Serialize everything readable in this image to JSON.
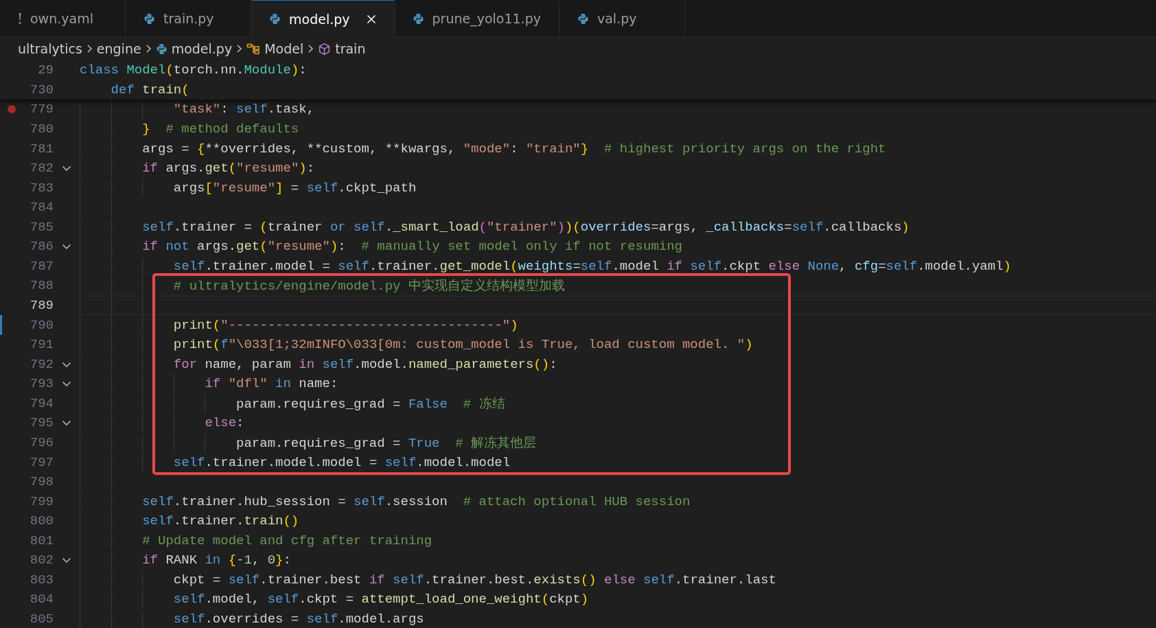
{
  "tabs": [
    {
      "label": "own.yaml",
      "kind": "yaml",
      "selected": false
    },
    {
      "label": "train.py",
      "kind": "python",
      "selected": false
    },
    {
      "label": "model.py",
      "kind": "python",
      "selected": true
    },
    {
      "label": "prune_yolo11.py",
      "kind": "python",
      "selected": false
    },
    {
      "label": "val.py",
      "kind": "python",
      "selected": false
    }
  ],
  "breadcrumb": [
    {
      "label": "ultralytics",
      "kind": "folder"
    },
    {
      "label": "engine",
      "kind": "folder"
    },
    {
      "label": "model.py",
      "kind": "python"
    },
    {
      "label": "Model",
      "kind": "class"
    },
    {
      "label": "train",
      "kind": "method"
    }
  ],
  "sticky_lines": [
    {
      "number": "29",
      "tokens": [
        {
          "kind": "kw",
          "text": "class"
        },
        {
          "kind": "cls",
          "text": " Model"
        },
        {
          "kind": "b1",
          "text": "("
        },
        {
          "kind": "plain",
          "text": "torch.nn."
        },
        {
          "kind": "cls",
          "text": "Module"
        },
        {
          "kind": "b1",
          "text": ")"
        },
        {
          "kind": "plain",
          "text": ":"
        }
      ]
    },
    {
      "number": "730",
      "tokens": [
        {
          "kind": "kw",
          "text": "    def"
        },
        {
          "kind": "fn",
          "text": " train"
        },
        {
          "kind": "b1",
          "text": "("
        }
      ]
    }
  ],
  "lines": [
    {
      "number": "779",
      "breakpoint": true,
      "tokens": [
        {
          "kind": "str",
          "text": "            \"task\""
        },
        {
          "kind": "plain",
          "text": ": "
        },
        {
          "kind": "kw",
          "text": "self"
        },
        {
          "kind": "plain",
          "text": ".task,"
        }
      ]
    },
    {
      "number": "780",
      "tokens": [
        {
          "kind": "b1",
          "text": "        }"
        },
        {
          "kind": "cmt",
          "text": "  # method defaults"
        }
      ]
    },
    {
      "number": "781",
      "tokens": [
        {
          "kind": "plain",
          "text": "        args = "
        },
        {
          "kind": "b1",
          "text": "{"
        },
        {
          "kind": "plain",
          "text": "**overrides, **custom, **kwargs, "
        },
        {
          "kind": "str",
          "text": "\"mode\""
        },
        {
          "kind": "plain",
          "text": ": "
        },
        {
          "kind": "str",
          "text": "\"train\""
        },
        {
          "kind": "b1",
          "text": "}"
        },
        {
          "kind": "cmt",
          "text": "  # highest priority args on the right"
        }
      ]
    },
    {
      "number": "782",
      "expanded": true,
      "tokens": [
        {
          "kind": "ctrl",
          "text": "        if"
        },
        {
          "kind": "plain",
          "text": " args."
        },
        {
          "kind": "fn",
          "text": "get"
        },
        {
          "kind": "b1",
          "text": "("
        },
        {
          "kind": "str",
          "text": "\"resume\""
        },
        {
          "kind": "b1",
          "text": ")"
        },
        {
          "kind": "plain",
          "text": ":"
        }
      ]
    },
    {
      "number": "783",
      "tokens": [
        {
          "kind": "plain",
          "text": "            args"
        },
        {
          "kind": "b1",
          "text": "["
        },
        {
          "kind": "str",
          "text": "\"resume\""
        },
        {
          "kind": "b1",
          "text": "]"
        },
        {
          "kind": "plain",
          "text": " = "
        },
        {
          "kind": "kw",
          "text": "self"
        },
        {
          "kind": "plain",
          "text": ".ckpt_path"
        }
      ]
    },
    {
      "number": "784"
    },
    {
      "number": "785",
      "tokens": [
        {
          "kind": "kw",
          "text": "        self"
        },
        {
          "kind": "plain",
          "text": ".trainer = "
        },
        {
          "kind": "b1",
          "text": "("
        },
        {
          "kind": "plain",
          "text": "trainer "
        },
        {
          "kind": "kw",
          "text": "or"
        },
        {
          "kind": "kw",
          "text": " self"
        },
        {
          "kind": "plain",
          "text": "."
        },
        {
          "kind": "fn",
          "text": "_smart_load"
        },
        {
          "kind": "b2",
          "text": "("
        },
        {
          "kind": "str",
          "text": "\"trainer\""
        },
        {
          "kind": "b2",
          "text": ")"
        },
        {
          "kind": "b1",
          "text": ")("
        },
        {
          "kind": "param",
          "text": "overrides"
        },
        {
          "kind": "plain",
          "text": "=args, "
        },
        {
          "kind": "param",
          "text": "_callbacks"
        },
        {
          "kind": "plain",
          "text": "="
        },
        {
          "kind": "kw",
          "text": "self"
        },
        {
          "kind": "plain",
          "text": ".callbacks"
        },
        {
          "kind": "b1",
          "text": ")"
        }
      ]
    },
    {
      "number": "786",
      "expanded": true,
      "tokens": [
        {
          "kind": "ctrl",
          "text": "        if"
        },
        {
          "kind": "kw",
          "text": " not"
        },
        {
          "kind": "plain",
          "text": " args."
        },
        {
          "kind": "fn",
          "text": "get"
        },
        {
          "kind": "b1",
          "text": "("
        },
        {
          "kind": "str",
          "text": "\"resume\""
        },
        {
          "kind": "b1",
          "text": ")"
        },
        {
          "kind": "plain",
          "text": ":"
        },
        {
          "kind": "cmt",
          "text": "  # manually set model only if not resuming"
        }
      ]
    },
    {
      "number": "787",
      "tokens": [
        {
          "kind": "kw",
          "text": "            self"
        },
        {
          "kind": "plain",
          "text": ".trainer.model = "
        },
        {
          "kind": "kw",
          "text": "self"
        },
        {
          "kind": "plain",
          "text": ".trainer."
        },
        {
          "kind": "fn",
          "text": "get_model"
        },
        {
          "kind": "b1",
          "text": "("
        },
        {
          "kind": "param",
          "text": "weights"
        },
        {
          "kind": "plain",
          "text": "="
        },
        {
          "kind": "kw",
          "text": "self"
        },
        {
          "kind": "plain",
          "text": ".model "
        },
        {
          "kind": "ctrl",
          "text": "if"
        },
        {
          "kind": "kw",
          "text": " self"
        },
        {
          "kind": "plain",
          "text": ".ckpt "
        },
        {
          "kind": "ctrl",
          "text": "else"
        },
        {
          "kind": "kw",
          "text": " None"
        },
        {
          "kind": "plain",
          "text": ", "
        },
        {
          "kind": "param",
          "text": "cfg"
        },
        {
          "kind": "plain",
          "text": "="
        },
        {
          "kind": "kw",
          "text": "self"
        },
        {
          "kind": "plain",
          "text": ".model.yaml"
        },
        {
          "kind": "b1",
          "text": ")"
        }
      ]
    },
    {
      "number": "788",
      "annotated": true,
      "tokens": [
        {
          "kind": "cmt",
          "text": "            # ultralytics/engine/model.py 中实现自定义结构模型加载"
        }
      ]
    },
    {
      "number": "789",
      "annotated": true,
      "current": true
    },
    {
      "number": "790",
      "annotated": true,
      "modified": true,
      "tokens": [
        {
          "kind": "fn",
          "text": "            print"
        },
        {
          "kind": "b1",
          "text": "("
        },
        {
          "kind": "str",
          "text": "\"-----------------------------------\""
        },
        {
          "kind": "b1",
          "text": ")"
        }
      ]
    },
    {
      "number": "791",
      "annotated": true,
      "tokens": [
        {
          "kind": "fn",
          "text": "            print"
        },
        {
          "kind": "b1",
          "text": "("
        },
        {
          "kind": "kw",
          "text": "f"
        },
        {
          "kind": "str",
          "text": "\"\\033[1;32mINFO\\033[0m: custom_model is True, load custom model. \""
        },
        {
          "kind": "b1",
          "text": ")"
        }
      ]
    },
    {
      "number": "792",
      "annotated": true,
      "expanded": true,
      "tokens": [
        {
          "kind": "ctrl",
          "text": "            for"
        },
        {
          "kind": "plain",
          "text": " name, param "
        },
        {
          "kind": "ctrl",
          "text": "in"
        },
        {
          "kind": "kw",
          "text": " self"
        },
        {
          "kind": "plain",
          "text": ".model."
        },
        {
          "kind": "fn",
          "text": "named_parameters"
        },
        {
          "kind": "b1",
          "text": "()"
        },
        {
          "kind": "plain",
          "text": ":"
        }
      ]
    },
    {
      "number": "793",
      "annotated": true,
      "expanded": true,
      "tokens": [
        {
          "kind": "ctrl",
          "text": "                if"
        },
        {
          "kind": "str",
          "text": " \"dfl\""
        },
        {
          "kind": "kw",
          "text": " in"
        },
        {
          "kind": "plain",
          "text": " name:"
        }
      ]
    },
    {
      "number": "794",
      "annotated": true,
      "tokens": [
        {
          "kind": "plain",
          "text": "                    param.requires_grad = "
        },
        {
          "kind": "kw",
          "text": "False"
        },
        {
          "kind": "cmt",
          "text": "  # 冻结"
        }
      ]
    },
    {
      "number": "795",
      "annotated": true,
      "expanded": true,
      "tokens": [
        {
          "kind": "ctrl",
          "text": "                else"
        },
        {
          "kind": "plain",
          "text": ":"
        }
      ]
    },
    {
      "number": "796",
      "annotated": true,
      "tokens": [
        {
          "kind": "plain",
          "text": "                    param.requires_grad = "
        },
        {
          "kind": "kw",
          "text": "True"
        },
        {
          "kind": "cmt",
          "text": "  # 解冻其他层"
        }
      ]
    },
    {
      "number": "797",
      "annotated": true,
      "tokens": [
        {
          "kind": "kw",
          "text": "            self"
        },
        {
          "kind": "plain",
          "text": ".trainer.model.model = "
        },
        {
          "kind": "kw",
          "text": "self"
        },
        {
          "kind": "plain",
          "text": ".model.model"
        }
      ]
    },
    {
      "number": "798"
    },
    {
      "number": "799",
      "tokens": [
        {
          "kind": "kw",
          "text": "        self"
        },
        {
          "kind": "plain",
          "text": ".trainer.hub_session = "
        },
        {
          "kind": "kw",
          "text": "self"
        },
        {
          "kind": "plain",
          "text": ".session"
        },
        {
          "kind": "cmt",
          "text": "  # attach optional HUB session"
        }
      ]
    },
    {
      "number": "800",
      "tokens": [
        {
          "kind": "kw",
          "text": "        self"
        },
        {
          "kind": "plain",
          "text": ".trainer."
        },
        {
          "kind": "fn",
          "text": "train"
        },
        {
          "kind": "b1",
          "text": "()"
        }
      ]
    },
    {
      "number": "801",
      "tokens": [
        {
          "kind": "cmt",
          "text": "        # Update model and cfg after training"
        }
      ]
    },
    {
      "number": "802",
      "expanded": true,
      "tokens": [
        {
          "kind": "ctrl",
          "text": "        if"
        },
        {
          "kind": "plain",
          "text": " RANK "
        },
        {
          "kind": "kw",
          "text": "in"
        },
        {
          "kind": "b1",
          "text": " {"
        },
        {
          "kind": "num",
          "text": "-1"
        },
        {
          "kind": "plain",
          "text": ", "
        },
        {
          "kind": "num",
          "text": "0"
        },
        {
          "kind": "b1",
          "text": "}"
        },
        {
          "kind": "plain",
          "text": ":"
        }
      ]
    },
    {
      "number": "803",
      "tokens": [
        {
          "kind": "plain",
          "text": "            ckpt = "
        },
        {
          "kind": "kw",
          "text": "self"
        },
        {
          "kind": "plain",
          "text": ".trainer.best "
        },
        {
          "kind": "ctrl",
          "text": "if"
        },
        {
          "kind": "kw",
          "text": " self"
        },
        {
          "kind": "plain",
          "text": ".trainer.best."
        },
        {
          "kind": "fn",
          "text": "exists"
        },
        {
          "kind": "b1",
          "text": "()"
        },
        {
          "kind": "ctrl",
          "text": " else"
        },
        {
          "kind": "kw",
          "text": " self"
        },
        {
          "kind": "plain",
          "text": ".trainer.last"
        }
      ]
    },
    {
      "number": "804",
      "tokens": [
        {
          "kind": "kw",
          "text": "            self"
        },
        {
          "kind": "plain",
          "text": ".model, "
        },
        {
          "kind": "kw",
          "text": "self"
        },
        {
          "kind": "plain",
          "text": ".ckpt = "
        },
        {
          "kind": "fn",
          "text": "attempt_load_one_weight"
        },
        {
          "kind": "b1",
          "text": "("
        },
        {
          "kind": "plain",
          "text": "ckpt"
        },
        {
          "kind": "b1",
          "text": ")"
        }
      ]
    },
    {
      "number": "805",
      "tokens": [
        {
          "kind": "kw",
          "text": "            self"
        },
        {
          "kind": "plain",
          "text": ".overrides = "
        },
        {
          "kind": "kw",
          "text": "self"
        },
        {
          "kind": "plain",
          "text": ".model.args"
        }
      ]
    }
  ]
}
